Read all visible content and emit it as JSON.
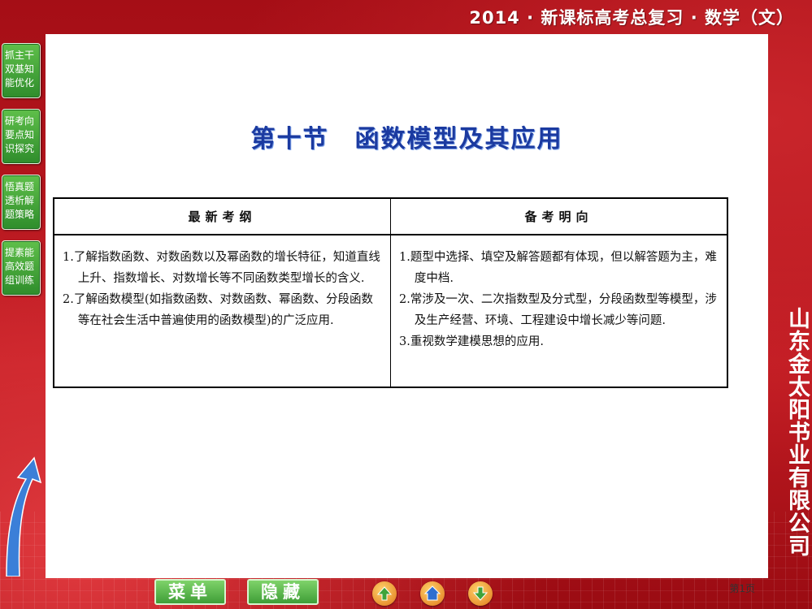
{
  "header": {
    "title": "2014 · 新课标高考总复习 · 数学（文）"
  },
  "sidebar": {
    "items": [
      {
        "label": "抓主干双基知能优化"
      },
      {
        "label": "研考向要点知识探究"
      },
      {
        "label": "悟真题透析解题策略"
      },
      {
        "label": "提素能高效题组训练"
      }
    ]
  },
  "section": {
    "title": "第十节　函数模型及其应用"
  },
  "table": {
    "headers": [
      "最新考纲",
      "备考明向"
    ],
    "left_items": [
      "1.了解指数函数、对数函数以及幂函数的增长特征，知道直线上升、指数增长、对数增长等不同函数类型增长的含义.",
      "2.了解函数模型(如指数函数、对数函数、幂函数、分段函数等在社会生活中普遍使用的函数模型)的广泛应用."
    ],
    "right_items": [
      "1.题型中选择、填空及解答题都有体现，但以解答题为主，难度中档.",
      "2.常涉及一次、二次指数型及分式型，分段函数型等模型，涉及生产经营、环境、工程建设中增长减少等问题.",
      "3.重视数学建模思想的应用."
    ]
  },
  "company": "山东金太阳书业有限公司",
  "bottom": {
    "menu_label": "菜单",
    "hide_label": "隐藏",
    "page": "第1页"
  },
  "colors": {
    "background": "#b3121b",
    "nav_green": "#3f9e37",
    "title_blue": "#1b3aa0"
  },
  "icons": [
    "up-arrow-icon",
    "home-icon",
    "down-arrow-icon"
  ]
}
